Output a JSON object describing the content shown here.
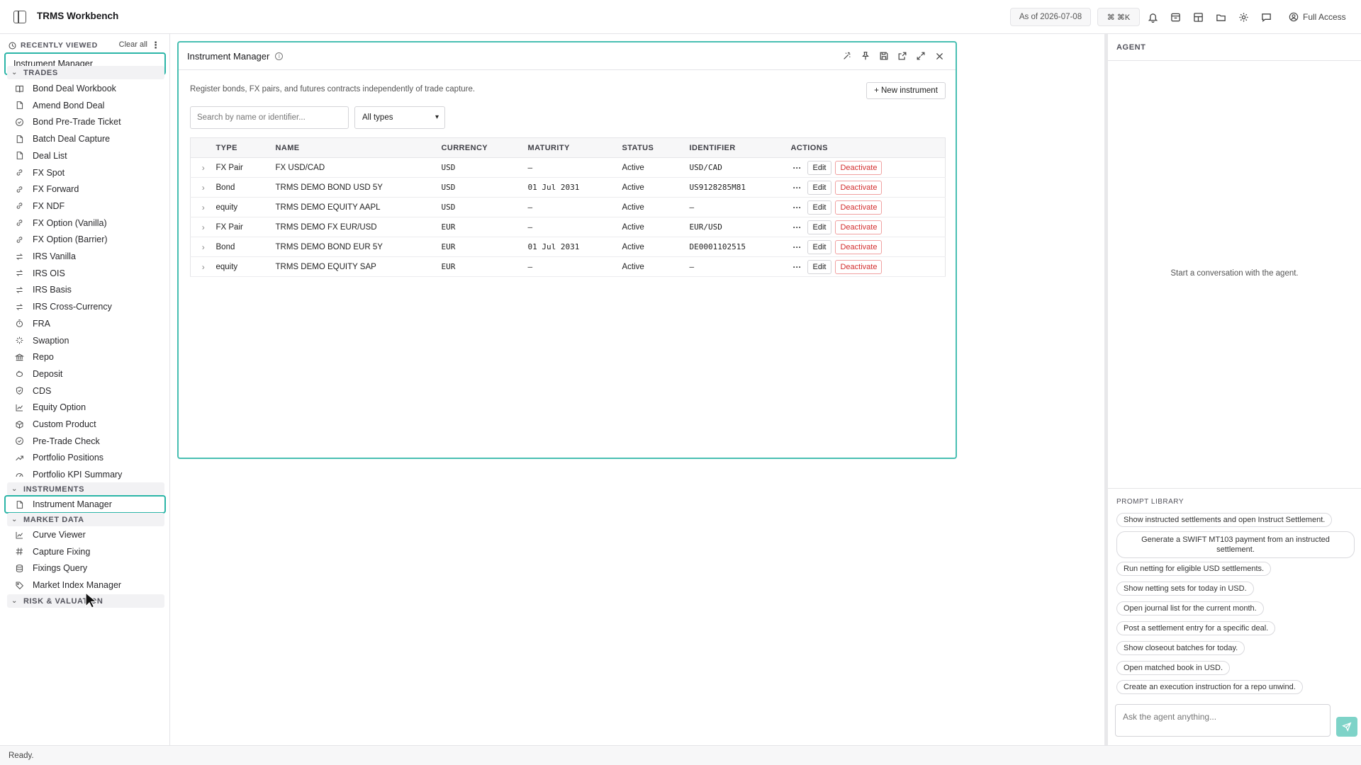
{
  "app": {
    "title": "TRMS Workbench"
  },
  "header": {
    "as_of": "As of 2026-07-08",
    "shortcut": "⌘ ⌘K",
    "full_access": "Full Access",
    "icons": [
      "bell-icon",
      "inbox-icon",
      "layout-icon",
      "folder-icon",
      "gear-icon",
      "chat-icon"
    ]
  },
  "sidebar": {
    "recently_viewed": {
      "title": "RECENTLY VIEWED",
      "clear_label": "Clear all",
      "items": [
        "Instrument Manager"
      ]
    },
    "sections": [
      {
        "title": "TRADES",
        "items": [
          {
            "label": "Bond Deal Workbook",
            "icon": "book-icon"
          },
          {
            "label": "Amend Bond Deal",
            "icon": "document-icon"
          },
          {
            "label": "Bond Pre-Trade Ticket",
            "icon": "check-circle-icon"
          },
          {
            "label": "Batch Deal Capture",
            "icon": "document-icon"
          },
          {
            "label": "Deal List",
            "icon": "document-icon"
          },
          {
            "label": "FX Spot",
            "icon": "link-icon"
          },
          {
            "label": "FX Forward",
            "icon": "link-icon"
          },
          {
            "label": "FX NDF",
            "icon": "link-icon"
          },
          {
            "label": "FX Option (Vanilla)",
            "icon": "link-icon"
          },
          {
            "label": "FX Option (Barrier)",
            "icon": "link-icon"
          },
          {
            "label": "IRS Vanilla",
            "icon": "swap-icon"
          },
          {
            "label": "IRS OIS",
            "icon": "swap-icon"
          },
          {
            "label": "IRS Basis",
            "icon": "swap-icon"
          },
          {
            "label": "IRS Cross-Currency",
            "icon": "swap-icon"
          },
          {
            "label": "FRA",
            "icon": "timer-icon"
          },
          {
            "label": "Swaption",
            "icon": "sparkle-icon"
          },
          {
            "label": "Repo",
            "icon": "bank-icon"
          },
          {
            "label": "Deposit",
            "icon": "piggy-bank-icon"
          },
          {
            "label": "CDS",
            "icon": "shield-icon"
          },
          {
            "label": "Equity Option",
            "icon": "chart-icon"
          },
          {
            "label": "Custom Product",
            "icon": "box-icon"
          },
          {
            "label": "Pre-Trade Check",
            "icon": "check-circle-icon"
          },
          {
            "label": "Portfolio Positions",
            "icon": "trend-icon"
          },
          {
            "label": "Portfolio KPI Summary",
            "icon": "gauge-icon"
          }
        ]
      },
      {
        "title": "INSTRUMENTS",
        "items": [
          {
            "label": "Instrument Manager",
            "icon": "document-icon"
          }
        ]
      },
      {
        "title": "MARKET DATA",
        "items": [
          {
            "label": "Curve Viewer",
            "icon": "chart-icon"
          },
          {
            "label": "Capture Fixing",
            "icon": "hash-icon"
          },
          {
            "label": "Fixings Query",
            "icon": "database-icon"
          },
          {
            "label": "Market Index Manager",
            "icon": "tag-icon"
          }
        ]
      },
      {
        "title": "RISK & VALUATION",
        "items": []
      }
    ]
  },
  "panel": {
    "title": "Instrument Manager",
    "description": "Register bonds, FX pairs, and futures contracts independently of trade capture.",
    "new_button": "+ New instrument",
    "search_placeholder": "Search by name or identifier...",
    "type_filter": "All types",
    "columns": [
      "TYPE",
      "NAME",
      "CURRENCY",
      "MATURITY",
      "STATUS",
      "IDENTIFIER",
      "ACTIONS"
    ],
    "rows": [
      {
        "type": "FX Pair",
        "name": "FX USD/CAD",
        "currency": "USD",
        "maturity": "—",
        "status": "Active",
        "identifier": "USD/CAD"
      },
      {
        "type": "Bond",
        "name": "TRMS DEMO BOND USD 5Y",
        "currency": "USD",
        "maturity": "01 Jul 2031",
        "status": "Active",
        "identifier": "US9128285M81"
      },
      {
        "type": "equity",
        "name": "TRMS DEMO EQUITY AAPL",
        "currency": "USD",
        "maturity": "—",
        "status": "Active",
        "identifier": "—"
      },
      {
        "type": "FX Pair",
        "name": "TRMS DEMO FX EUR/USD",
        "currency": "EUR",
        "maturity": "—",
        "status": "Active",
        "identifier": "EUR/USD"
      },
      {
        "type": "Bond",
        "name": "TRMS DEMO BOND EUR 5Y",
        "currency": "EUR",
        "maturity": "01 Jul 2031",
        "status": "Active",
        "identifier": "DE0001102515"
      },
      {
        "type": "equity",
        "name": "TRMS DEMO EQUITY SAP",
        "currency": "EUR",
        "maturity": "—",
        "status": "Active",
        "identifier": "—"
      }
    ],
    "row_actions": {
      "more": "···",
      "edit": "Edit",
      "deactivate": "Deactivate"
    }
  },
  "agent": {
    "title": "AGENT",
    "empty_text": "Start a conversation with the agent.",
    "prompt_library_title": "PROMPT LIBRARY",
    "prompts": [
      "Show instructed settlements and open Instruct Settlement.",
      "Generate a SWIFT MT103 payment from an instructed settlement.",
      "Run netting for eligible USD settlements.",
      "Show netting sets for today in USD.",
      "Open journal list for the current month.",
      "Post a settlement entry for a specific deal.",
      "Show closeout batches for today.",
      "Open matched book in USD.",
      "Create an execution instruction for a repo unwind."
    ],
    "input_placeholder": "Ask the agent anything..."
  },
  "status": {
    "text": "Ready."
  },
  "colors": {
    "accent": "#2bb5a7",
    "danger": "#d32f2f",
    "send": "#7ed3c8"
  }
}
